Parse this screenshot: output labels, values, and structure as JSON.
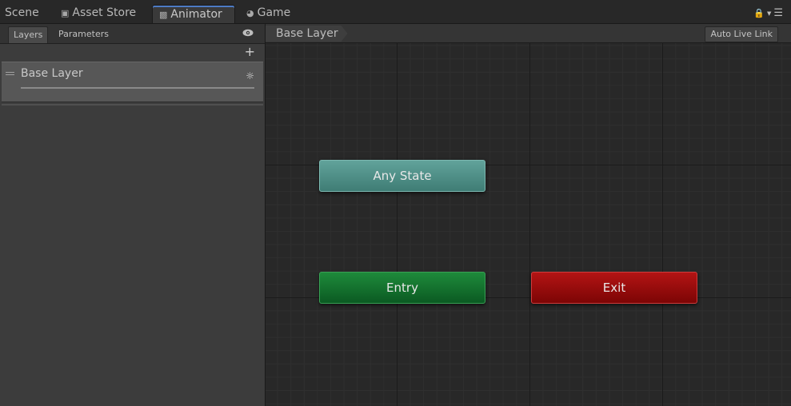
{
  "tabs": {
    "scene": "Scene",
    "asset_store": "Asset Store",
    "animator": "Animator",
    "game": "Game"
  },
  "left_panel": {
    "subtabs": [
      "Layers",
      "Parameters"
    ],
    "add_symbol": "+",
    "layers": [
      {
        "name": "Base Layer"
      }
    ]
  },
  "graph": {
    "breadcrumb": "Base Layer",
    "live_link_label": "Auto Live Link",
    "nodes": {
      "any_state": "Any State",
      "entry": "Entry",
      "exit": "Exit"
    }
  },
  "colors": {
    "any_state": "#4f8f87",
    "entry": "#13722f",
    "exit": "#9b0c0c",
    "active_tab_accent": "#4d7bc4"
  }
}
